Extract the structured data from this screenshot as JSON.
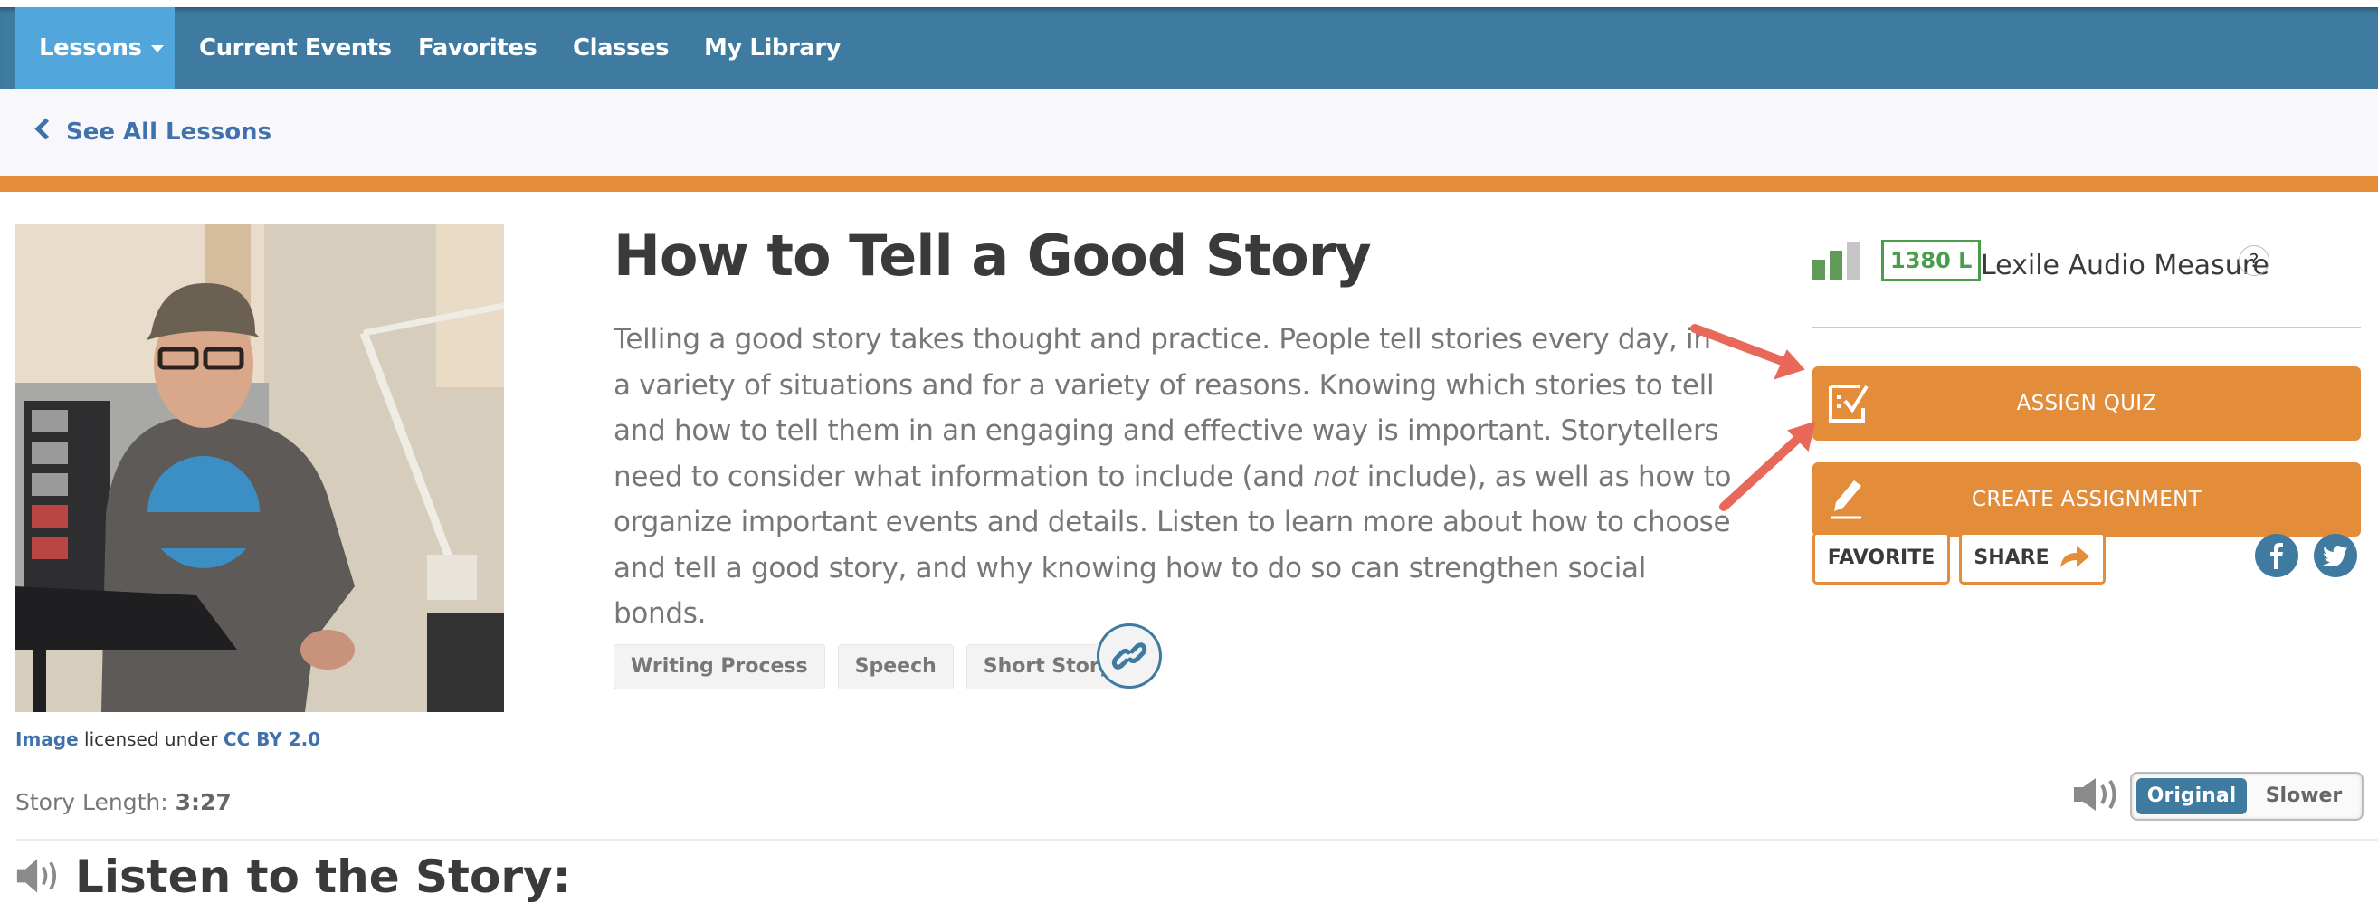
{
  "nav": {
    "items": [
      {
        "label": "Lessons",
        "active": true,
        "has_dropdown": true
      },
      {
        "label": "Current Events"
      },
      {
        "label": "Favorites"
      },
      {
        "label": "Classes"
      },
      {
        "label": "My Library"
      }
    ]
  },
  "subnav": {
    "back_label": "See All Lessons"
  },
  "lesson": {
    "title": "How to Tell a Good Story",
    "description_before_em": "Telling a good story takes thought and practice. People tell stories every day, in a variety of situations and for a variety of reasons. Knowing which stories to tell and how to tell them in an engaging and effective way is important. Storytellers need to consider what information to include (and ",
    "description_em": "not",
    "description_after_em": " include), as well as how to organize important events and details. Listen to learn more about how to choose and tell a good story, and why knowing how to do so can strengthen social bonds.",
    "tags": [
      "Writing Process",
      "Speech",
      "Short Story"
    ],
    "image_credit": {
      "image_link": "Image",
      "middle": " licensed under ",
      "license_link": "CC BY 2.0"
    },
    "story_length_label": "Story Length: ",
    "story_length_value": "3:27",
    "listen_heading": "Listen to the Story:"
  },
  "lexile": {
    "value": "1380 L",
    "label": "Lexile Audio Measure",
    "help": "?",
    "level_bars_filled": 2,
    "level_bars_total": 3
  },
  "actions": {
    "assign_quiz": "ASSIGN QUIZ",
    "create_assignment": "CREATE ASSIGNMENT",
    "favorite": "FAVORITE",
    "share": "SHARE"
  },
  "social": [
    "facebook",
    "twitter"
  ],
  "audio": {
    "speed_options": [
      "Original",
      "Slower"
    ],
    "selected": "Original"
  },
  "colors": {
    "nav_bg": "#3f7aa0",
    "nav_active": "#51a6dc",
    "accent_orange": "#e38d3a",
    "link_blue": "#3f72ac",
    "lexile_green": "#4a9d4d",
    "annotation_arrow": "#e8685a"
  }
}
